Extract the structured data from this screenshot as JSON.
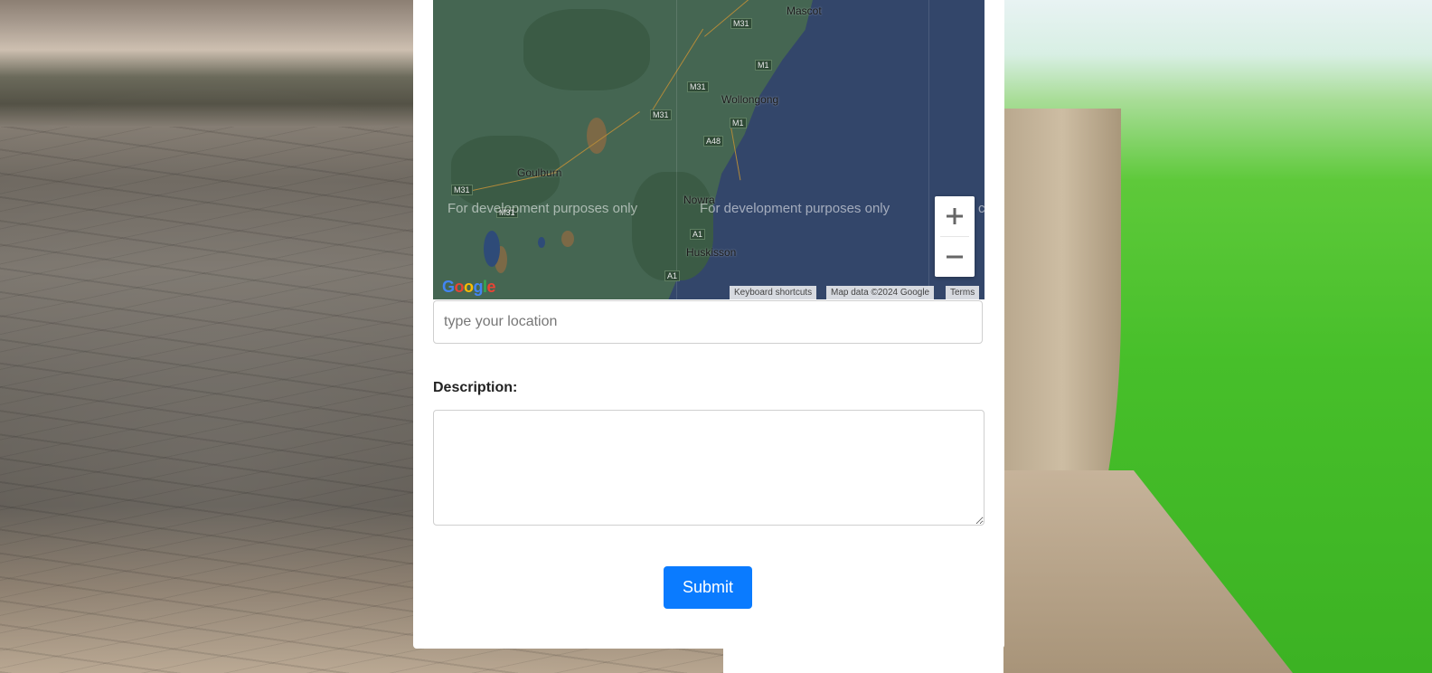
{
  "map": {
    "cities": [
      "Mascot",
      "Wollongong",
      "Goulburn",
      "Nowra",
      "Huskisson"
    ],
    "road_shields": [
      "M31",
      "M31",
      "M1",
      "M31",
      "M1",
      "M31",
      "A48",
      "M31",
      "A1",
      "A1",
      "A1"
    ],
    "watermark": "For development purposes only",
    "watermark_partial": "c",
    "zoom_in_icon": "plus-icon",
    "zoom_out_icon": "minus-icon",
    "attribution": {
      "shortcuts": "Keyboard shortcuts",
      "data": "Map data ©2024 Google",
      "terms": "Terms"
    },
    "logo": "Google",
    "colors": {
      "water": "#33466a",
      "land": "#456652"
    }
  },
  "form": {
    "location_placeholder": "type your location",
    "description_label": "Description:",
    "submit_label": "Submit",
    "accent": "#0a7bff"
  }
}
